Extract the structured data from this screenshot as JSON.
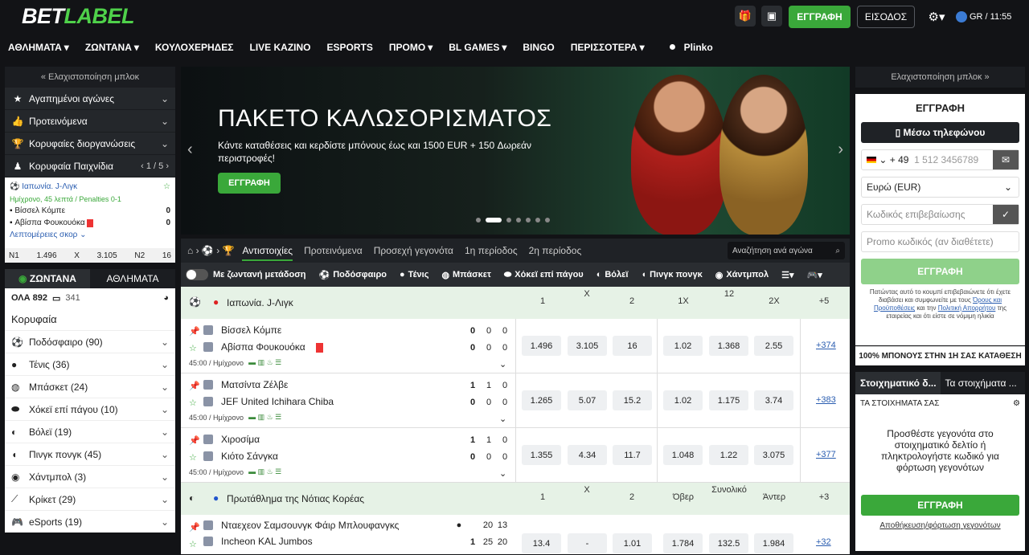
{
  "header": {
    "logo_a": "BET",
    "logo_b": "LABEL",
    "gift_badge": "1",
    "register": "ΕΓΓΡΑΦΗ",
    "login": "ΕΙΣΟΔΟΣ",
    "lang": "GR / 11:55"
  },
  "nav": [
    "ΑΘΛΗΜΑΤΑ",
    "ΖΩΝΤΑΝΑ",
    "ΚΟΥΛΟΧΕΡΗΔΕΣ",
    "LIVE ΚΑΖΙΝΟ",
    "ESPORTS",
    "ΠΡΟΜΟ",
    "BL GAMES",
    "BINGO",
    "ΠΕΡΙΣΣΟΤΕΡΑ",
    "Plinko"
  ],
  "left": {
    "minimize": "« Ελαχιστοποίηση μπλοκ",
    "menu": [
      "Αγαπημένοι αγώνες",
      "Προτεινόμενα",
      "Κορυφαίες διοργανώσεις",
      "Κορυφαία Παιχνίδια"
    ],
    "pager": "1 / 5",
    "card": {
      "league": "Ιαπωνία. J-Λιγκ",
      "status": "Ημίχρονο, 45 λεπτά / Penalties 0-1",
      "team1": "Βίσσελ Κόμπε",
      "score1": "0",
      "team2": "Αβίσπα Φουκουόκα",
      "score2": "0",
      "details": "Λεπτομέρειες σκορ",
      "odds": [
        "N1",
        "1.496",
        "X",
        "3.105",
        "N2",
        "16"
      ]
    },
    "tabs": [
      "ΖΩΝΤΑΝΑ",
      "ΑΘΛΗΜΑΤΑ"
    ],
    "all_label": "ΟΛΑ 892",
    "screens": "341",
    "top_label": "Κορυφαία",
    "sports": [
      "Ποδόσφαιρο (90)",
      "Τένις (36)",
      "Μπάσκετ (24)",
      "Χόκεϊ επί πάγου (10)",
      "Βόλεϊ (19)",
      "Πινγκ πονγκ (45)",
      "Χάντμπολ (3)",
      "Κρίκετ (29)",
      "eSports (19)"
    ]
  },
  "banner": {
    "title": "ΠΑΚΕΤΟ ΚΑΛΩΣΟΡΙΣΜΑΤΟΣ",
    "text": "Κάντε καταθέσεις και κερδίστε μπόνους έως και 1500 EUR + 150 Δωρεάν περιστροφές!",
    "button": "ΕΓΓΡΑΦΗ"
  },
  "main": {
    "tabs": [
      "Αντιστοιχίες",
      "Προτεινόμενα",
      "Προσεχή γεγονότα",
      "1η περίοδος",
      "2η περίοδος"
    ],
    "search": "Αναζήτηση ανά αγώνα",
    "live": "Με ζωντανή μετάδοση",
    "sports": [
      "Ποδόσφαιρο",
      "Τένις",
      "Μπάσκετ",
      "Χόκεϊ επί πάγου",
      "Βόλεϊ",
      "Πινγκ πονγκ",
      "Χάντμπολ"
    ],
    "league1": {
      "name": "Ιαπωνία. J-Λιγκ",
      "cols": [
        "1",
        "X",
        "2",
        "1X",
        "12",
        "2X",
        "+5"
      ]
    },
    "events": [
      {
        "t1": "Βίσσελ Κόμπε",
        "t2": "Αβίσπα Φουκουόκα",
        "s1": [
          "0",
          "0",
          "0"
        ],
        "s2": [
          "0",
          "0",
          "0"
        ],
        "time": "45:00 / Ημίχρονο",
        "odds": [
          "1.496",
          "3.105",
          "16",
          "1.02",
          "1.368",
          "2.55"
        ],
        "more": "+374"
      },
      {
        "t1": "Ματσίντα Ζέλβε",
        "t2": "JEF United Ichihara Chiba",
        "s1": [
          "1",
          "1",
          "0"
        ],
        "s2": [
          "0",
          "0",
          "0"
        ],
        "time": "45:00 / Ημίχρονο",
        "odds": [
          "1.265",
          "5.07",
          "15.2",
          "1.02",
          "1.175",
          "3.74"
        ],
        "more": "+383"
      },
      {
        "t1": "Χιροσίμα",
        "t2": "Κιότο Σάνγκα",
        "s1": [
          "1",
          "1",
          "0"
        ],
        "s2": [
          "0",
          "0",
          "0"
        ],
        "time": "45:00 / Ημίχρονο",
        "odds": [
          "1.355",
          "4.34",
          "11.7",
          "1.048",
          "1.22",
          "3.075"
        ],
        "more": "+377"
      }
    ],
    "league2": {
      "name": "Πρωτάθλημα της Νότιας Κορέας",
      "cols": [
        "1",
        "X",
        "2",
        "Όβερ",
        "Συνολικό",
        "Άντερ",
        "+3"
      ]
    },
    "event4": {
      "t1": "Νταεχεον Σαμσουνγκ Φάιρ Μπλουφανγκς",
      "t2": "Incheon KAL Jumbos",
      "s1": [
        "20",
        "13"
      ],
      "s2": [
        "1",
        "25",
        "20"
      ],
      "odds": [
        "13.4",
        "-",
        "1.01",
        "1.784",
        "132.5",
        "1.984"
      ],
      "more": "+32"
    }
  },
  "right": {
    "minimize": "Ελαχιστοποίηση μπλοκ »",
    "title": "ΕΓΓΡΑΦΗ",
    "phone_btn": "Μέσω τηλεφώνου",
    "code": "+ 49",
    "phone_ph": "1 512 3456789",
    "currency": "Ευρώ (EUR)",
    "confirm_ph": "Κωδικός επιβεβαίωσης",
    "promo_ph": "Promo κωδικός (αν διαθέτετε)",
    "register": "ΕΓΓΡΑΦΗ",
    "terms_a": "Πατώντας αυτό το κουμπί επιβεβαιώνετε ότι έχετε διαβάσει και συμφωνείτε με τους",
    "terms_link1": "Όρους και Προϋποθέσεις",
    "terms_b": "και την",
    "terms_link2": "Πολιτική Απορρήτου",
    "terms_c": "της εταιρείας και ότι είστε σε νόμιμη ηλικία",
    "bonus": "100% ΜΠΟΝΟΥΣ ΣΤΗΝ 1Η ΣΑΣ ΚΑΤΑΘΕΣΗ",
    "bs_tabs": [
      "Στοιχηματικό δ...",
      "Τα στοιχήματα ..."
    ],
    "bs_head": "ΤΑ ΣΤΟΙΧΗΜΑΤΑ ΣΑΣ",
    "bs_msg": "Προσθέστε γεγονότα στο στοιχηματικό δελτίο ή πληκτρολογήστε κωδικό για φόρτωση γεγονότων",
    "bs_btn": "ΕΓΓΡΑΦΗ",
    "bs_link": "Αποθήκευση/φόρτωση γεγονότων"
  }
}
